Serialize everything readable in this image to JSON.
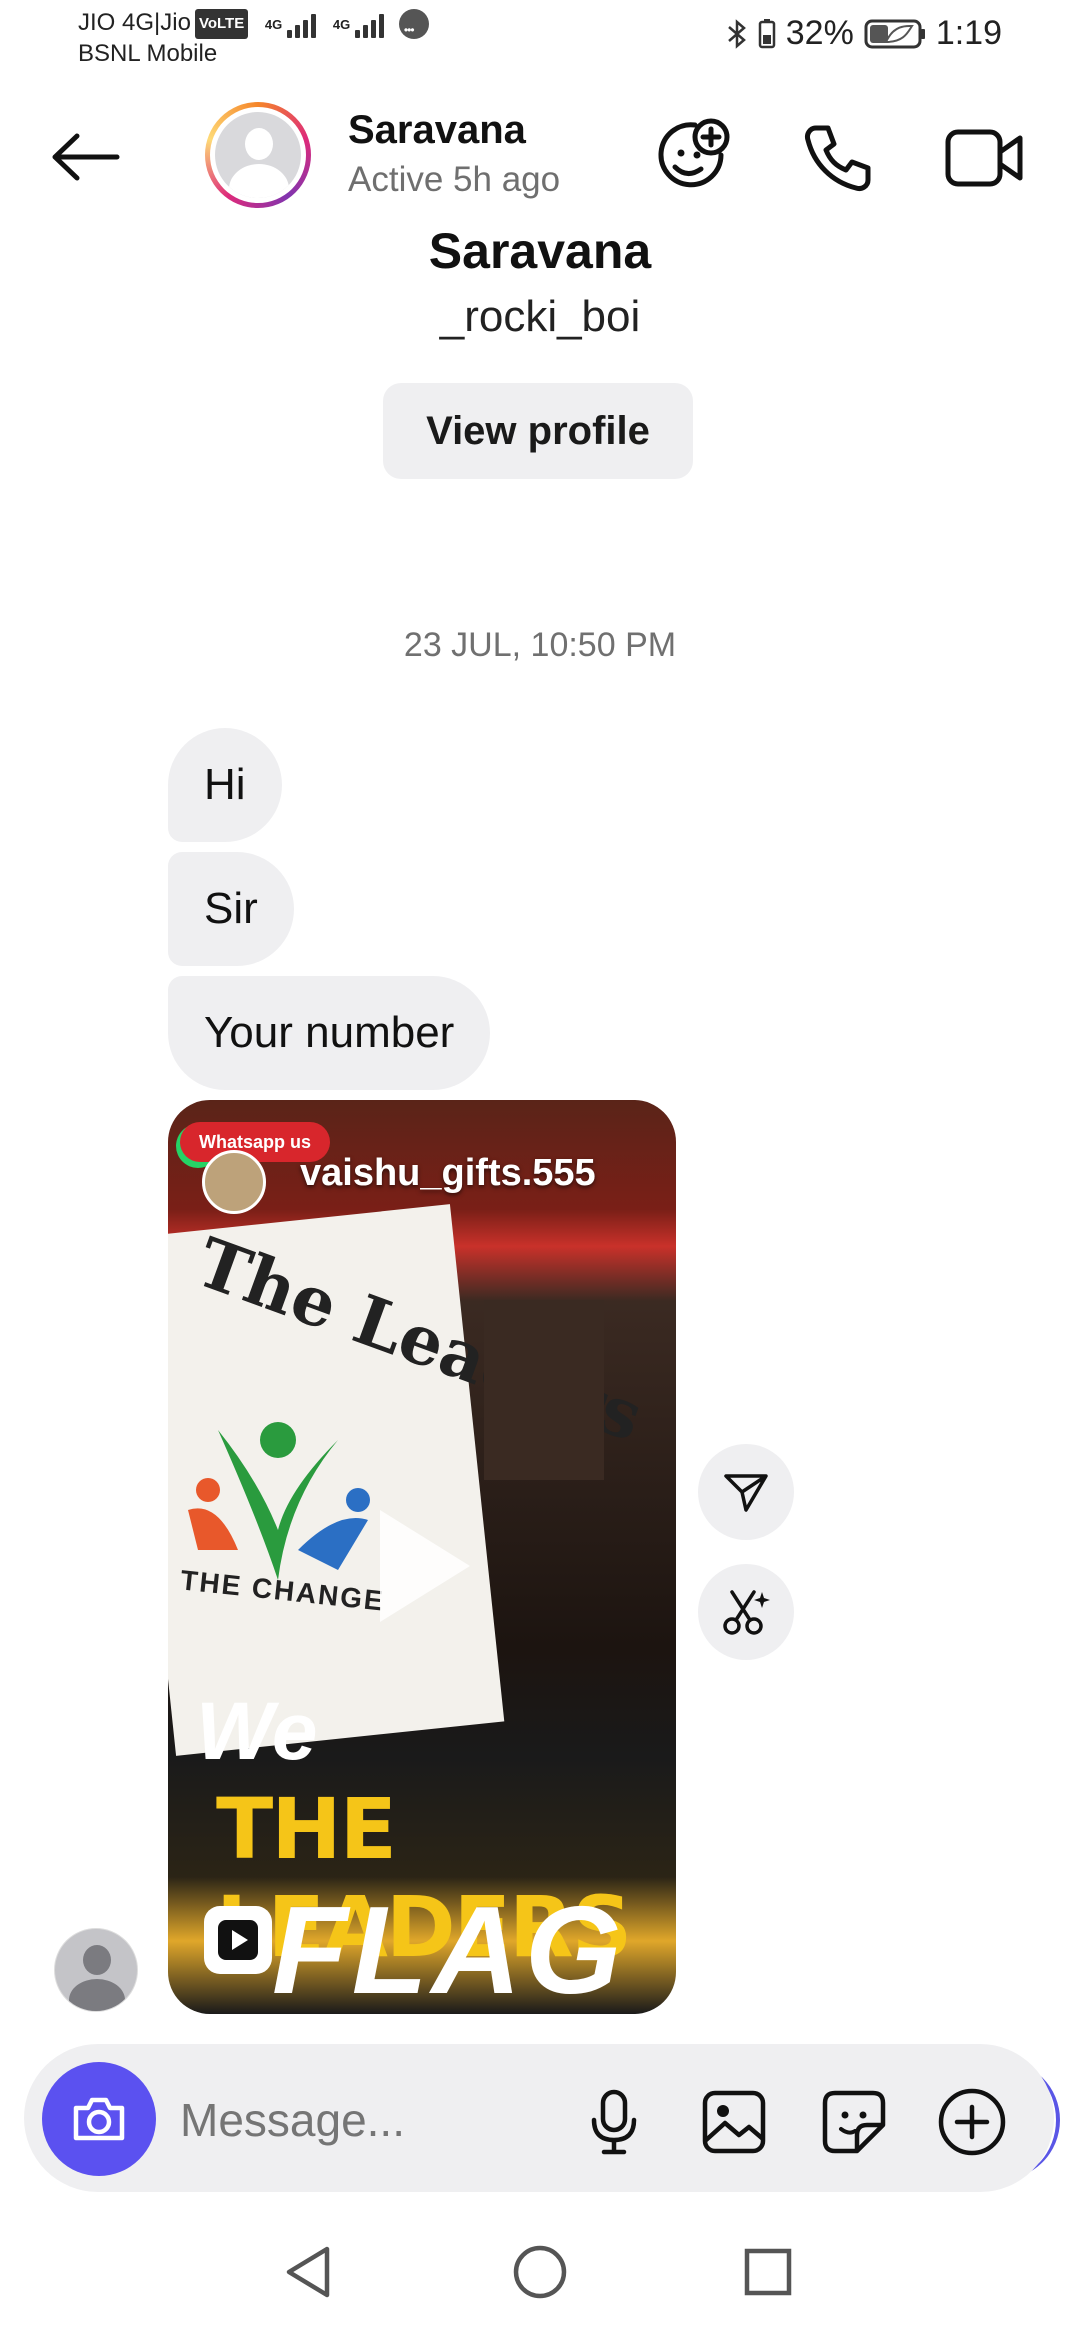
{
  "status_bar": {
    "carrier_line1": "JIO 4G|Jio",
    "volte_badge": "VoLTE",
    "net_label_1": "4G",
    "net_label_2": "4G",
    "carrier_line2": "BSNL Mobile",
    "battery_percent": "32%",
    "time": "1:19"
  },
  "header": {
    "contact_name": "Saravana",
    "active_status": "Active 5h ago",
    "icons": [
      "back-arrow-icon",
      "add-people-icon",
      "phone-icon",
      "video-camera-icon"
    ]
  },
  "profile": {
    "name": "Saravana",
    "username": "_rocki_boi",
    "view_profile_label": "View profile"
  },
  "conversation": {
    "timestamp": "23 JUL, 10:50 PM",
    "messages": [
      {
        "text": "Hi"
      },
      {
        "text": "Sir"
      },
      {
        "text": "Your number"
      }
    ],
    "shared_reel": {
      "owner": "vaishu_gifts.555",
      "badge_text": "Whatsapp us",
      "logo_text": "The Leaders",
      "tagline": "THE CHANGE",
      "line1": "We",
      "line2": "THE LEADERS",
      "line3": "FLAG"
    },
    "side_actions": [
      "share-icon",
      "remix-scissors-icon"
    ]
  },
  "composer": {
    "placeholder": "Message...",
    "icons": [
      "camera-icon",
      "microphone-icon",
      "gallery-icon",
      "sticker-icon",
      "plus-icon"
    ],
    "accent_color": "#5b51f0"
  },
  "nav_bar": {
    "icons": [
      "back-triangle-icon",
      "home-circle-icon",
      "recents-square-icon"
    ]
  }
}
